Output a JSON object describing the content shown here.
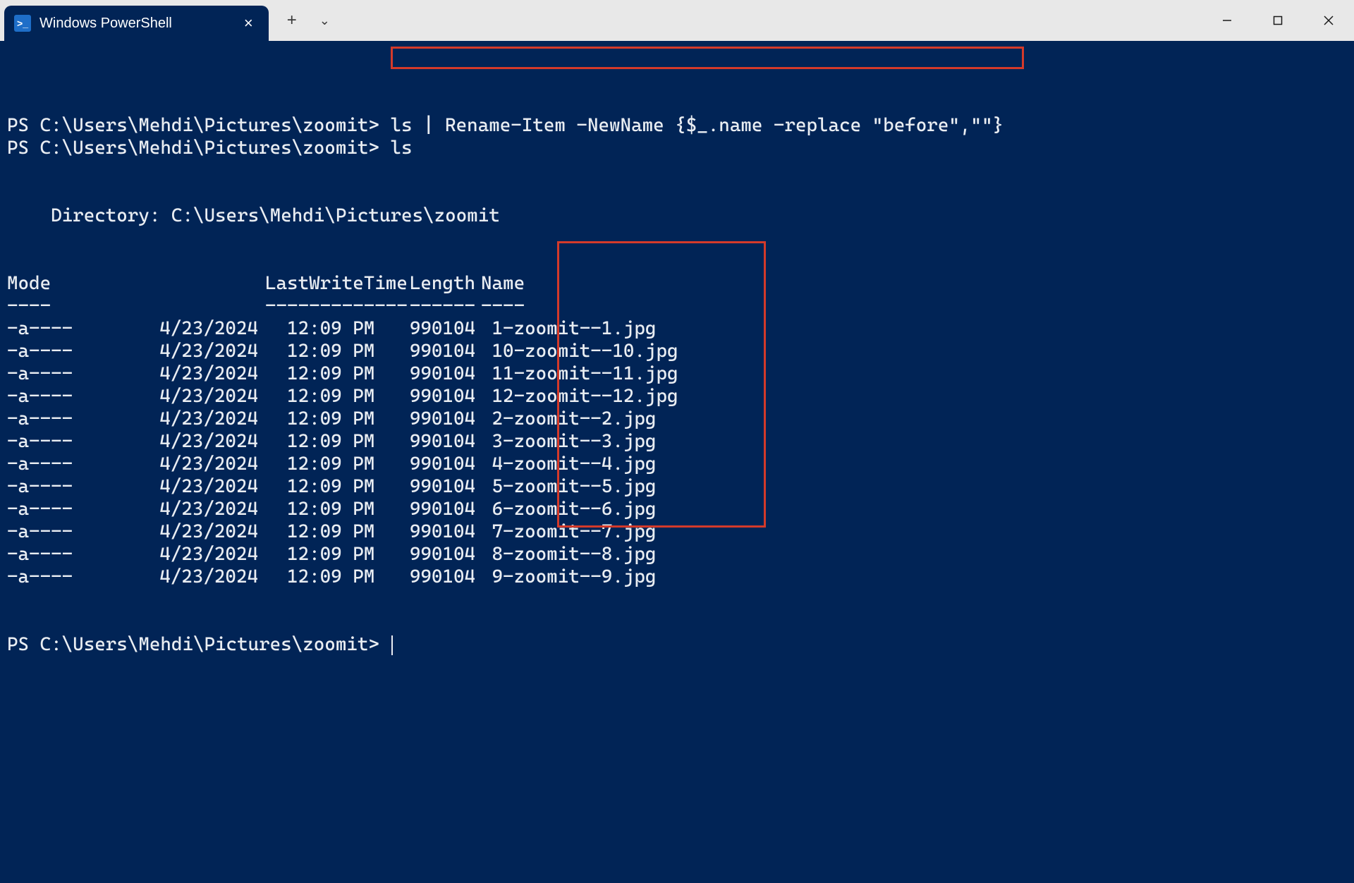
{
  "window": {
    "tab_title": "Windows PowerShell",
    "new_tab_icon": "+",
    "dropdown_icon": "⌄"
  },
  "prompt": "PS C:\\Users\\Mehdi\\Pictures\\zoomit>",
  "cmd1": "ls | Rename-Item -NewName {$_.name -replace \"before\",\"\"}",
  "cmd2": "ls",
  "dir_label": "Directory:",
  "dir_path": "C:\\Users\\Mehdi\\Pictures\\zoomit",
  "headers": {
    "mode": "Mode",
    "lwt": "LastWriteTime",
    "len": "Length",
    "name": "Name"
  },
  "dashes": {
    "mode": "----",
    "lwt": "-------------",
    "len": "------",
    "name": "----"
  },
  "rows": [
    {
      "mode": "-a----",
      "date": "4/23/2024",
      "time": "12:09 PM",
      "len": "990104",
      "name": "1-zoomit--1.jpg"
    },
    {
      "mode": "-a----",
      "date": "4/23/2024",
      "time": "12:09 PM",
      "len": "990104",
      "name": "10-zoomit--10.jpg"
    },
    {
      "mode": "-a----",
      "date": "4/23/2024",
      "time": "12:09 PM",
      "len": "990104",
      "name": "11-zoomit--11.jpg"
    },
    {
      "mode": "-a----",
      "date": "4/23/2024",
      "time": "12:09 PM",
      "len": "990104",
      "name": "12-zoomit--12.jpg"
    },
    {
      "mode": "-a----",
      "date": "4/23/2024",
      "time": "12:09 PM",
      "len": "990104",
      "name": "2-zoomit--2.jpg"
    },
    {
      "mode": "-a----",
      "date": "4/23/2024",
      "time": "12:09 PM",
      "len": "990104",
      "name": "3-zoomit--3.jpg"
    },
    {
      "mode": "-a----",
      "date": "4/23/2024",
      "time": "12:09 PM",
      "len": "990104",
      "name": "4-zoomit--4.jpg"
    },
    {
      "mode": "-a----",
      "date": "4/23/2024",
      "time": "12:09 PM",
      "len": "990104",
      "name": "5-zoomit--5.jpg"
    },
    {
      "mode": "-a----",
      "date": "4/23/2024",
      "time": "12:09 PM",
      "len": "990104",
      "name": "6-zoomit--6.jpg"
    },
    {
      "mode": "-a----",
      "date": "4/23/2024",
      "time": "12:09 PM",
      "len": "990104",
      "name": "7-zoomit--7.jpg"
    },
    {
      "mode": "-a----",
      "date": "4/23/2024",
      "time": "12:09 PM",
      "len": "990104",
      "name": "8-zoomit--8.jpg"
    },
    {
      "mode": "-a----",
      "date": "4/23/2024",
      "time": "12:09 PM",
      "len": "990104",
      "name": "9-zoomit--9.jpg"
    }
  ]
}
